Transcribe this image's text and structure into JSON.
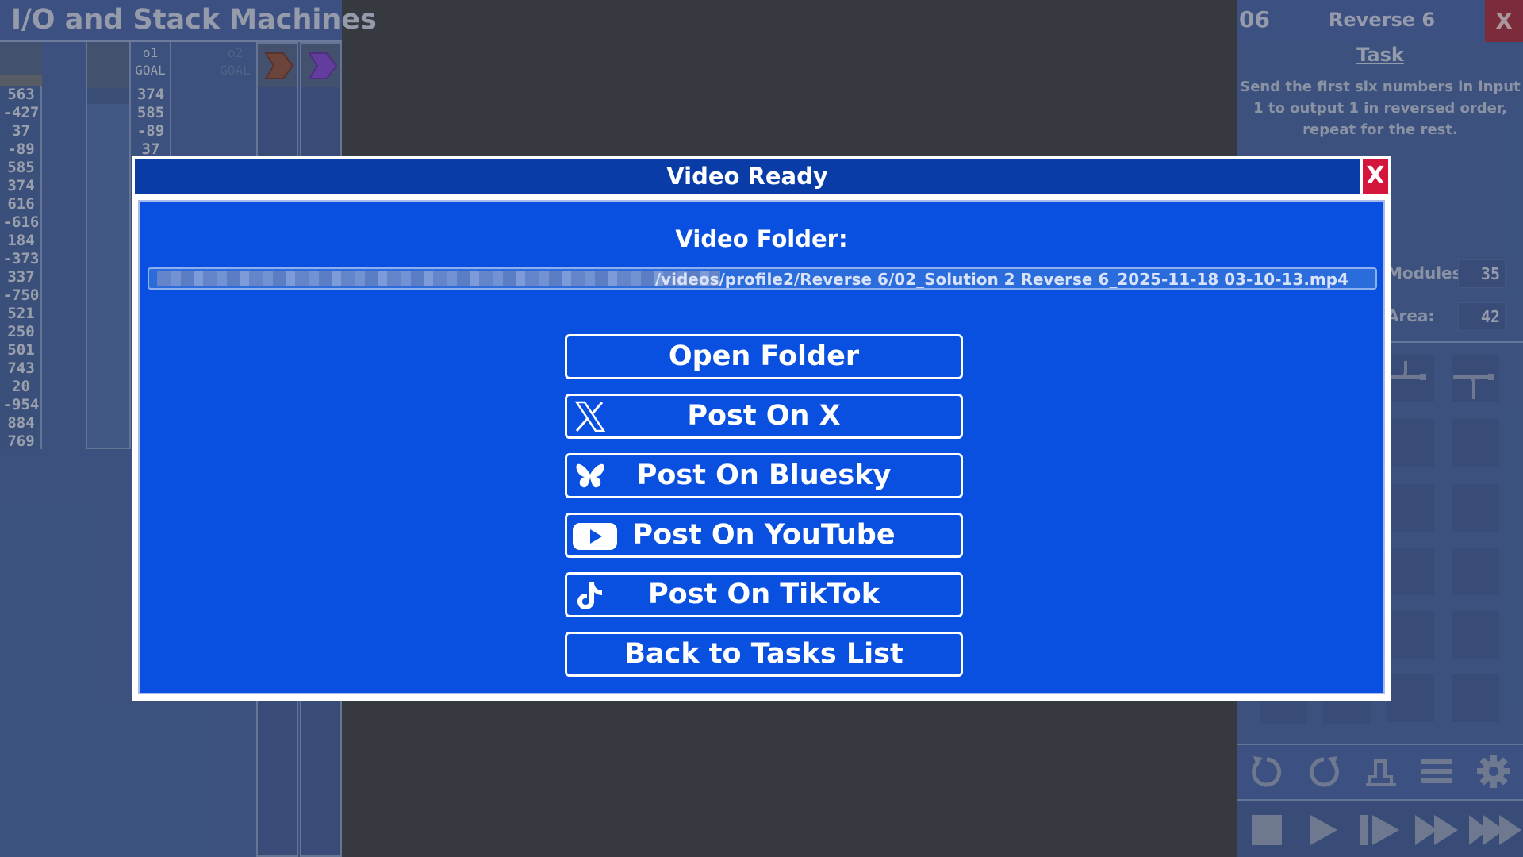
{
  "background_left": {
    "title": "I/O and Stack Machines",
    "goal_header": [
      "o1",
      "GOAL"
    ],
    "o2_header": [
      "o2",
      "GOAL"
    ],
    "input_values": [
      "563",
      "-427",
      "37",
      "-89",
      "585",
      "374",
      "616",
      "-616",
      "184",
      "-373",
      "337",
      "-750",
      "521",
      "250",
      "501",
      "743",
      "20",
      "-954",
      "884",
      "769"
    ],
    "goal_values": [
      "374",
      "585",
      "-89",
      "37"
    ]
  },
  "background_right": {
    "task_number": "06",
    "task_name": "Reverse 6",
    "close_label": "X",
    "task_heading": "Task",
    "task_description": "Send the first six numbers in input 1 to output 1 in reversed order, repeat for the rest.",
    "modules_label": "Modules:",
    "modules_value": "35",
    "area_label": "Area:",
    "area_value": "42",
    "toolbar_icons": [
      "undo-icon",
      "redo-icon",
      "chart-icon",
      "menu-icon",
      "settings-icon"
    ],
    "playback_icons": [
      "stop-icon",
      "play-icon",
      "step-icon",
      "fast-forward-icon",
      "fastest-forward-icon"
    ]
  },
  "modal": {
    "title": "Video Ready",
    "close_label": "X",
    "folder_label": "Video Folder:",
    "path_visible": "/videos/profile2/Reverse 6/02_Solution 2 Reverse 6_2025-11-18 03-10-13.mp4",
    "buttons": [
      {
        "label": "Open Folder",
        "icon": ""
      },
      {
        "label": "Post On X",
        "icon": "x-logo-icon"
      },
      {
        "label": "Post On Bluesky",
        "icon": "bluesky-logo-icon"
      },
      {
        "label": "Post On YouTube",
        "icon": "youtube-logo-icon"
      },
      {
        "label": "Post On TikTok",
        "icon": "tiktok-logo-icon"
      },
      {
        "label": "Back to Tasks List",
        "icon": ""
      }
    ]
  },
  "colors": {
    "modal_title_bg": "#0a3ca8",
    "modal_body_bg": "#0a50e0",
    "close_red": "#d4163c",
    "app_bg": "#363a40",
    "panel_bg": "#3f5f9f"
  }
}
